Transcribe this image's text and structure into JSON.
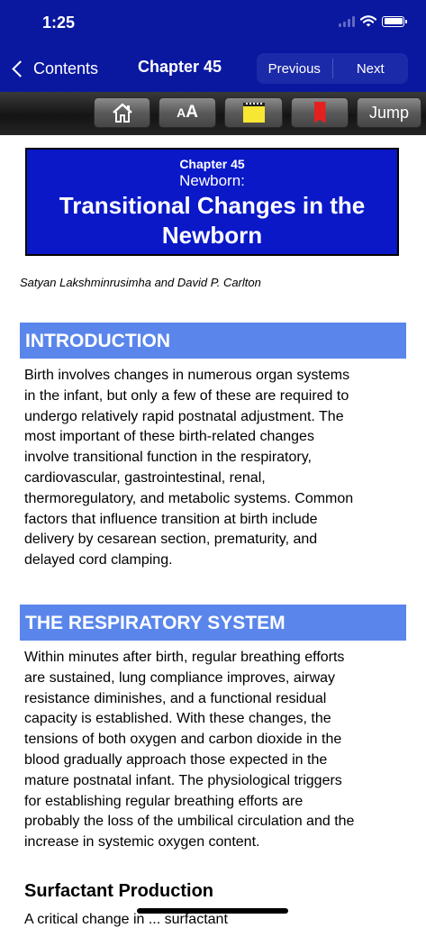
{
  "status": {
    "time": "1:25"
  },
  "nav": {
    "back_label": "Contents",
    "title": "Chapter 45",
    "previous_label": "Previous",
    "next_label": "Next"
  },
  "toolbar": {
    "home_icon": "home-icon",
    "font_size_label_small": "A",
    "font_size_label_large": "A",
    "notes_icon": "notepad-icon",
    "bookmark_icon": "bookmark-icon",
    "jump_label": "Jump"
  },
  "chapter": {
    "number": "Chapter 45",
    "subtitle": "Newborn:",
    "title_line1": "Transitional Changes in the",
    "title_line2": "Newborn"
  },
  "authors": "Satyan Lakshminrusimha and David P. Carlton",
  "sections": [
    {
      "heading": "INTRODUCTION",
      "lines": [
        "Birth involves changes in numerous organ systems",
        "in the infant, but only a few of these are required to",
        "undergo relatively rapid postnatal adjustment. The",
        "most important of these birth-related changes",
        "involve transitional function in the respiratory,",
        "cardiovascular, gastrointestinal, renal,",
        "thermoregulatory, and metabolic systems. Common",
        "factors that influence transition at birth include",
        "delivery by cesarean section, prematurity, and",
        "delayed cord clamping."
      ]
    },
    {
      "heading": "THE RESPIRATORY SYSTEM",
      "lines": [
        "Within minutes after birth, regular breathing efforts",
        "are sustained, lung compliance improves, airway",
        "resistance diminishes, and a functional residual",
        "capacity is established. With these changes, the",
        "tensions of both oxygen and carbon dioxide in the",
        "blood gradually approach those expected in the",
        "mature postnatal infant. The physiological triggers",
        "for establishing regular breathing efforts are",
        "probably the loss of the umbilical circulation and the",
        "increase in systemic oxygen content."
      ]
    }
  ],
  "subsection": {
    "heading": "Surfactant Production"
  },
  "clipped_text": "A critical change in ... surfactant"
}
